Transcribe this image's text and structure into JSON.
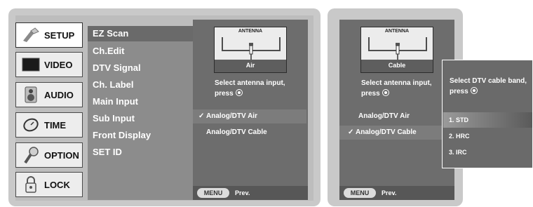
{
  "tabs": [
    {
      "icon": "setup-icon",
      "label": "SETUP"
    },
    {
      "icon": "video-icon",
      "label": "VIDEO"
    },
    {
      "icon": "audio-icon",
      "label": "AUDIO"
    },
    {
      "icon": "time-icon",
      "label": "TIME"
    },
    {
      "icon": "option-icon",
      "label": "OPTION"
    },
    {
      "icon": "lock-icon",
      "label": "LOCK"
    }
  ],
  "setup_menu": {
    "items": [
      "EZ Scan",
      "Ch.Edit",
      "DTV Signal",
      "Ch. Label",
      "Main Input",
      "Sub Input",
      "Front Display",
      "SET ID"
    ],
    "selected": "EZ Scan"
  },
  "screen1": {
    "antenna_title": "ANTENNA",
    "antenna_mode": "Air",
    "instruction_line1": "Select antenna input,",
    "instruction_line2": "press",
    "options": [
      "Analog/DTV Air",
      "Analog/DTV Cable"
    ],
    "selected_option": "Analog/DTV Air",
    "check_mark": "✓"
  },
  "screen2": {
    "antenna_title": "ANTENNA",
    "antenna_mode": "Cable",
    "instruction_line1": "Select antenna input,",
    "instruction_line2": "press",
    "options": [
      "Analog/DTV Air",
      "Analog/DTV Cable"
    ],
    "selected_option": "Analog/DTV Cable",
    "check_mark": "✓"
  },
  "cable_popup": {
    "instruction_line1": "Select DTV cable band,",
    "instruction_line2": "press",
    "bands": [
      "1. STD",
      "2. HRC",
      "3. IRC"
    ],
    "selected_band": "1. STD"
  },
  "footer": {
    "menu_button": "MENU",
    "prev_label": "Prev."
  }
}
